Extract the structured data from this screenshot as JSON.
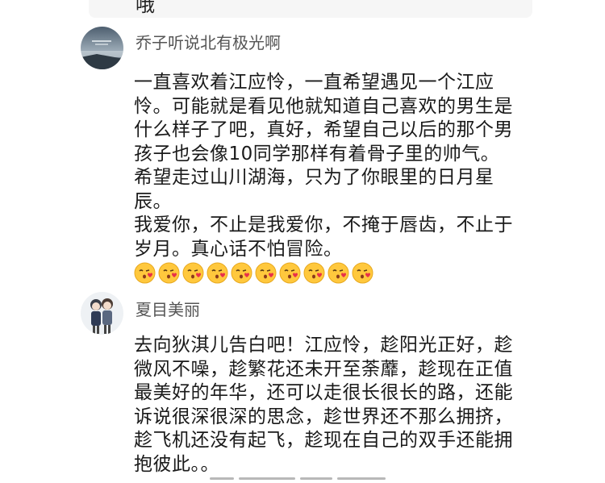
{
  "previous_comment": {
    "tail_text": "哦"
  },
  "comments": [
    {
      "username": "乔子听说北有极光啊",
      "avatar_icon": "landscape-avatar-icon",
      "paragraphs": [
        "一直喜欢着江应怜，一直希望遇见一个江应怜。可能就是看见他就知道自己喜欢的男生是什么样子了吧，真好，希望自己以后的那个男孩子也会像10同学那样有着骨子里的帅气。",
        "希望走过山川湖海，只为了你眼里的日月星辰。",
        "我爱你，不止是我爱你，不掩于唇齿，不止于岁月。真心话不怕冒险。"
      ],
      "emoji_name": "kissing-heart-emoji",
      "emoji_count": 10
    },
    {
      "username": "夏目美丽",
      "avatar_icon": "anime-couple-avatar-icon",
      "paragraphs": [
        "去向狄淇儿告白吧！江应怜，趁阳光正好，趁微风不噪，趁繁花还未开至荼蘼，趁现在正值最美好的年华，还可以走很长很长的路，还能诉说很深很深的思念，趁世界还不那么拥挤，趁飞机还没有起飞，趁现在自己的双手还能拥抱彼此。。"
      ]
    }
  ],
  "colors": {
    "username": "#555555",
    "text": "#1a1a1a",
    "background": "#ffffff"
  }
}
